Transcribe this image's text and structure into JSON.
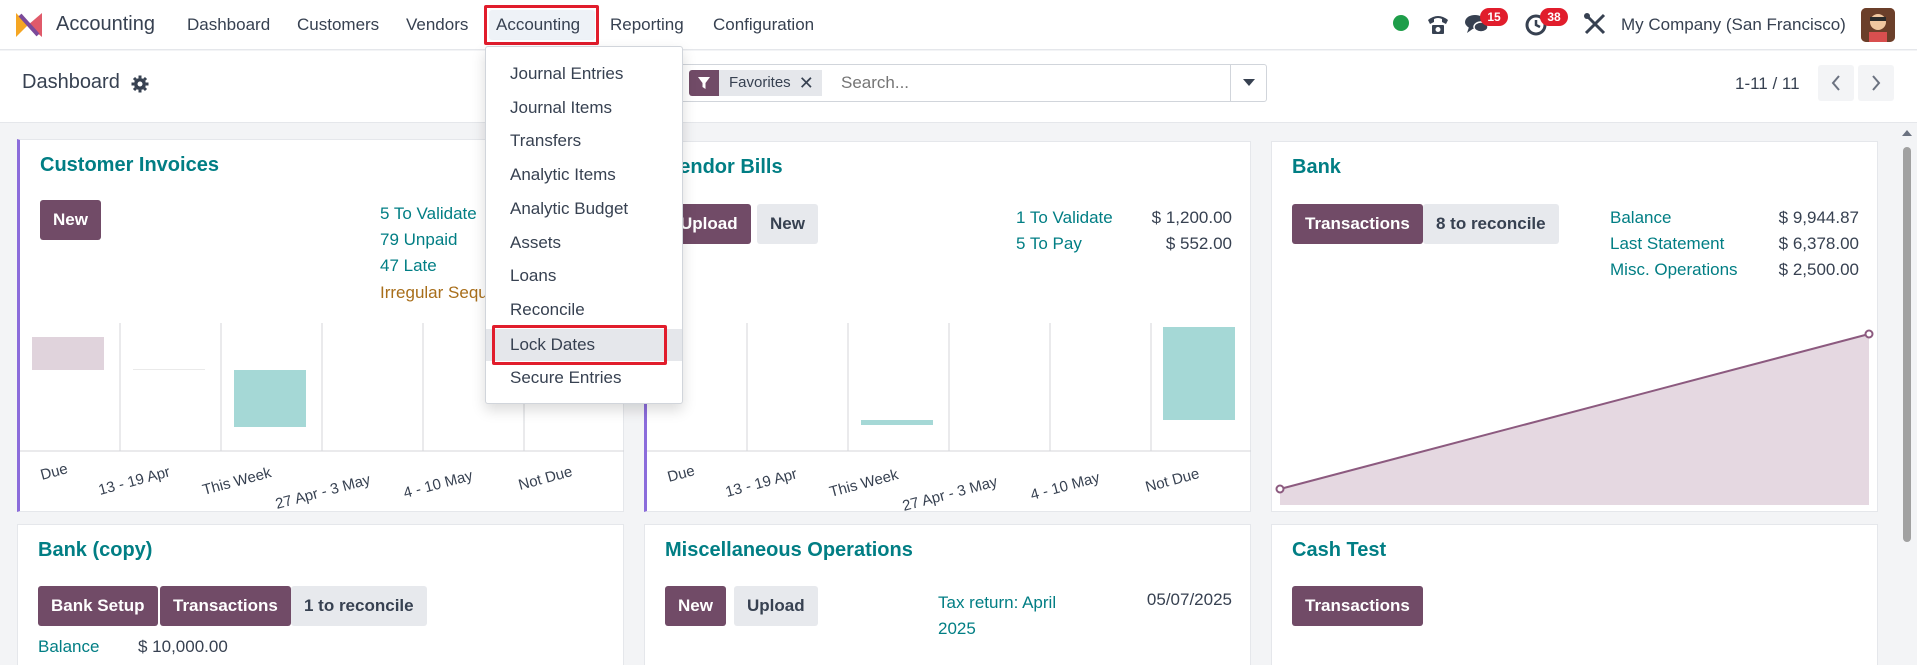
{
  "navbar": {
    "app_name": "Accounting",
    "menu": [
      "Dashboard",
      "Customers",
      "Vendors",
      "Accounting",
      "Reporting",
      "Configuration"
    ],
    "messages_badge": "15",
    "activities_badge": "38",
    "company": "My Company (San Francisco)"
  },
  "control": {
    "breadcrumb": "Dashboard",
    "facet_label": "Favorites",
    "search_placeholder": "Search...",
    "pager": "1-11 / 11"
  },
  "dropdown": {
    "items": [
      "Journal Entries",
      "Journal Items",
      "Transfers",
      "Analytic Items",
      "Analytic Budget",
      "Assets",
      "Loans",
      "Reconcile",
      "Lock Dates",
      "Secure Entries"
    ]
  },
  "cards": {
    "customer_invoices": {
      "title": "Customer Invoices",
      "new_label": "New",
      "links": [
        "5 To Validate",
        "79 Unpaid",
        "47 Late",
        "Irregular Sequ"
      ]
    },
    "vendor_bills": {
      "title": "Vendor Bills",
      "upload_label": "Upload",
      "new_label": "New",
      "links": [
        "1 To Validate",
        "5 To Pay"
      ],
      "amounts": [
        "$ 1,200.00",
        "$ 552.00"
      ]
    },
    "bank": {
      "title": "Bank",
      "transactions_label": "Transactions",
      "reconcile_label": "8 to reconcile",
      "links": [
        "Balance",
        "Last Statement",
        "Misc. Operations"
      ],
      "amounts": [
        "$ 9,944.87",
        "$ 6,378.00",
        "$ 2,500.00"
      ]
    },
    "bank_copy": {
      "title": "Bank (copy)",
      "setup_label": "Bank Setup",
      "transactions_label": "Transactions",
      "reconcile_label": "1 to reconcile",
      "balance_label": "Balance",
      "balance_amount": "$ 10,000.00"
    },
    "misc": {
      "title": "Miscellaneous Operations",
      "new_label": "New",
      "upload_label": "Upload",
      "tax_link": "Tax return: April 2025",
      "tax_date": "05/07/2025"
    },
    "cash": {
      "title": "Cash Test",
      "transactions_label": "Transactions"
    }
  },
  "chart_data": [
    {
      "type": "bar",
      "categories": [
        "Due",
        "13 - 19 Apr",
        "This Week",
        "27 Apr - 3 May",
        "4 - 10 May",
        "Not Due"
      ],
      "note_colors": {
        "Due": "#e0d3dc",
        "This Week": "#a5d8d6"
      }
    },
    {
      "type": "bar",
      "categories": [
        "Due",
        "13 - 19 Apr",
        "This Week",
        "27 Apr - 3 May",
        "4 - 10 May",
        "Not Due"
      ]
    },
    {
      "type": "area",
      "series": [
        {
          "values": [
            1,
            9
          ]
        }
      ]
    }
  ],
  "colors": {
    "brand": "#714b67",
    "link": "#017e84",
    "highlight": "#e11d2c"
  }
}
